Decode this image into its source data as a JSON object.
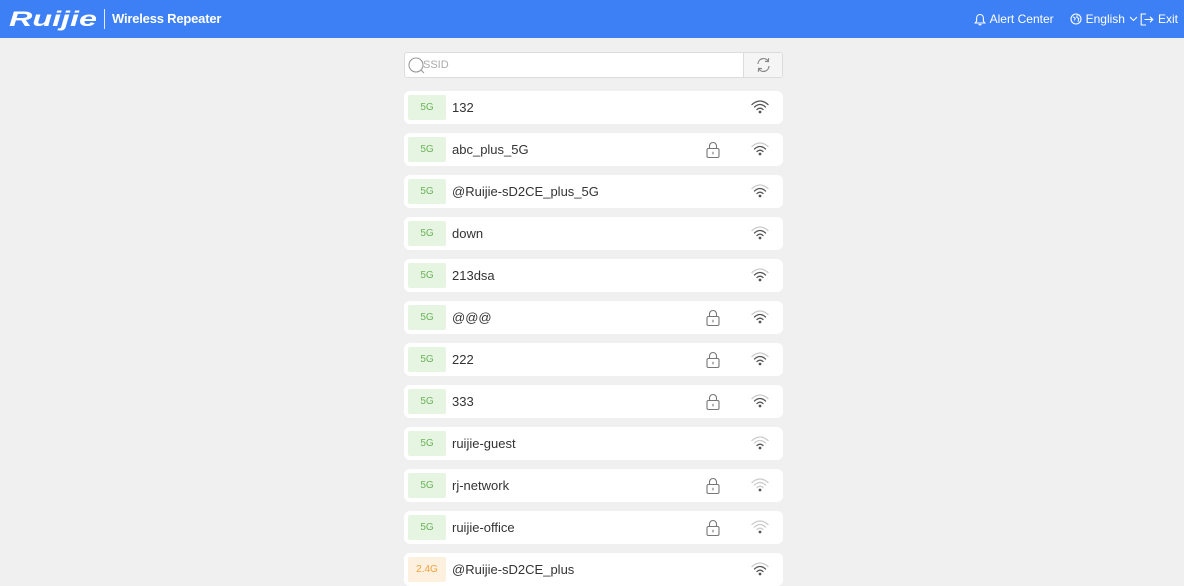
{
  "header": {
    "logo_text": "Ruijie",
    "title": "Wireless Repeater",
    "alert_center": "Alert Center",
    "language": "English",
    "exit": "Exit",
    "bar_color": "#3d7ff5"
  },
  "search": {
    "placeholder": "SSID",
    "value": ""
  },
  "icons": {
    "search": "search-icon",
    "refresh": "refresh-icon",
    "bell": "bell-icon",
    "globe": "globe-icon",
    "chevron": "chevron-down-icon",
    "exit": "exit-icon",
    "lock": "lock-icon",
    "wifi": "wifi-signal-icon"
  },
  "networks": [
    {
      "band": "5G",
      "ssid": "132",
      "locked": false,
      "signal": 4
    },
    {
      "band": "5G",
      "ssid": "abc_plus_5G",
      "locked": true,
      "signal": 3
    },
    {
      "band": "5G",
      "ssid": "@Ruijie-sD2CE_plus_5G",
      "locked": false,
      "signal": 3
    },
    {
      "band": "5G",
      "ssid": "down",
      "locked": false,
      "signal": 3
    },
    {
      "band": "5G",
      "ssid": "213dsa",
      "locked": false,
      "signal": 3
    },
    {
      "band": "5G",
      "ssid": "@@@",
      "locked": true,
      "signal": 3
    },
    {
      "band": "5G",
      "ssid": "222",
      "locked": true,
      "signal": 3
    },
    {
      "band": "5G",
      "ssid": "333",
      "locked": true,
      "signal": 3
    },
    {
      "band": "5G",
      "ssid": "ruijie-guest",
      "locked": false,
      "signal": 2
    },
    {
      "band": "5G",
      "ssid": "rj-network",
      "locked": true,
      "signal": 1
    },
    {
      "band": "5G",
      "ssid": "ruijie-office",
      "locked": true,
      "signal": 1
    },
    {
      "band": "2.4G",
      "ssid": "@Ruijie-sD2CE_plus",
      "locked": false,
      "signal": 3
    }
  ],
  "colors": {
    "band_5g_bg": "#e6f5e1",
    "band_5g_text": "#6bb35a",
    "band_24g_bg": "#fdf0de",
    "band_24g_text": "#f1a23b",
    "signal_on": "#555555",
    "signal_off": "#cccccc"
  }
}
